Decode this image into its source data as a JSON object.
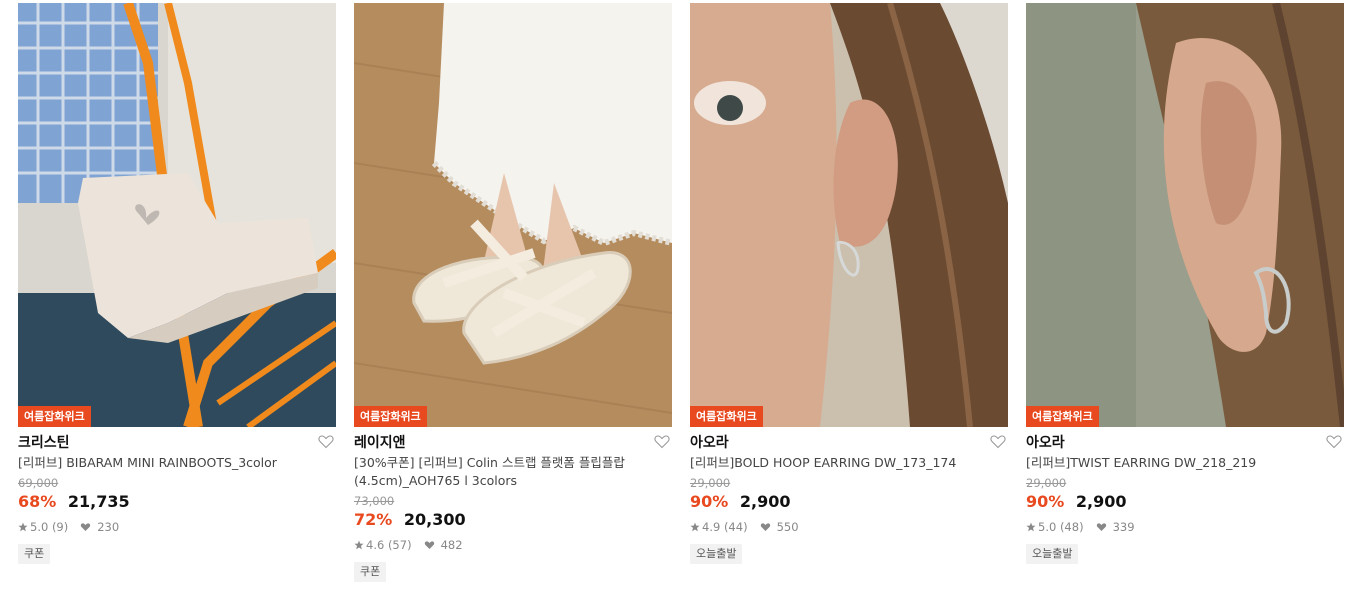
{
  "products": [
    {
      "badge": "여름잡화위크",
      "brand": "크리스틴",
      "name": "[리퍼브] BIBARAM MINI RAINBOOTS_3color",
      "original_price": "69,000",
      "discount": "68%",
      "price": "21,735",
      "rating": "5.0 (9)",
      "likes": "230",
      "tag": "쿠폰",
      "image_icon": "rain-boot-photo"
    },
    {
      "badge": "여름잡화위크",
      "brand": "레이지앤",
      "name": "[30%쿠폰] [리퍼브] Colin 스트랩 플랫폼 플립플랍 (4.5cm)_AOH765 l 3colors",
      "original_price": "73,000",
      "discount": "72%",
      "price": "20,300",
      "rating": "4.6 (57)",
      "likes": "482",
      "tag": "쿠폰",
      "image_icon": "platform-sandal-photo"
    },
    {
      "badge": "여름잡화위크",
      "brand": "아오라",
      "name": "[리퍼브]BOLD HOOP EARRING DW_173_174",
      "original_price": "29,000",
      "discount": "90%",
      "price": "2,900",
      "rating": "4.9 (44)",
      "likes": "550",
      "tag": "오늘출발",
      "image_icon": "hoop-earring-photo"
    },
    {
      "badge": "여름잡화위크",
      "brand": "아오라",
      "name": "[리퍼브]TWIST EARRING DW_218_219",
      "original_price": "29,000",
      "discount": "90%",
      "price": "2,900",
      "rating": "5.0 (48)",
      "likes": "339",
      "tag": "오늘출발",
      "image_icon": "twist-earring-photo"
    }
  ],
  "colors": {
    "accent": "#e8491f",
    "text": "#111111",
    "muted": "#888888"
  }
}
